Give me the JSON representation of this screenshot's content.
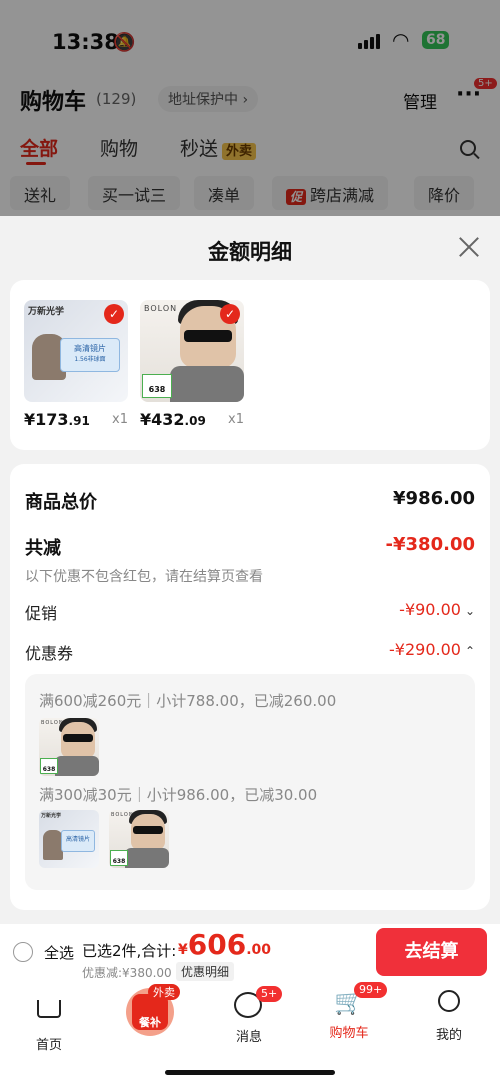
{
  "status_bar": {
    "time": "13:38",
    "battery": "68"
  },
  "header": {
    "title": "购物车",
    "count": "(129)",
    "address": "地址保护中 ›",
    "manage": "管理",
    "more_badge": "5+"
  },
  "tabs": [
    {
      "label": "全部"
    },
    {
      "label": "购物"
    },
    {
      "label": "秒送",
      "tag": "外卖"
    }
  ],
  "filters": [
    "送礼",
    "买一试三",
    "凑单",
    "跨店满减",
    "降价"
  ],
  "filter_promo_tag": "促",
  "sheet": {
    "title": "金额明细",
    "products": [
      {
        "brand": "万新光学",
        "box_text": "高清镜片",
        "box_sub": "1.56非球面",
        "price_main": "¥173",
        "price_dec": ".91",
        "qty": "x1"
      },
      {
        "brand": "BOLON",
        "tag": "638",
        "price_main": "¥432",
        "price_dec": ".09",
        "qty": "x1"
      }
    ],
    "summary": {
      "total_label": "商品总价",
      "total_value": "¥986.00",
      "reduce_label": "共减",
      "reduce_value": "-¥380.00",
      "reduce_note": "以下优惠不包含红包，请在结算页查看",
      "promo_label": "促销",
      "promo_value": "-¥90.00",
      "coupon_label": "优惠券",
      "coupon_value": "-¥290.00"
    },
    "coupons": [
      {
        "text": "满600减260元｜小计788.00，已减260.00"
      },
      {
        "text": "满300减30元｜小计986.00，已减30.00"
      }
    ]
  },
  "bottom_bar": {
    "select_all": "全选",
    "selected": "已选2件,合计:",
    "total_symbol": "¥",
    "total_int": "606",
    "total_dec": ".00",
    "discount": "优惠减:¥380.00",
    "detail": "优惠明细",
    "checkout": "去结算"
  },
  "nav": {
    "home": "首页",
    "eat_badge": "外卖",
    "eat_label": "餐补",
    "messages": "消息",
    "messages_badge": "5+",
    "cart": "购物车",
    "cart_badge": "99+",
    "me": "我的"
  },
  "colors": {
    "accent": "#e4281b",
    "checkout": "#f0303a",
    "battery": "#34c759"
  }
}
